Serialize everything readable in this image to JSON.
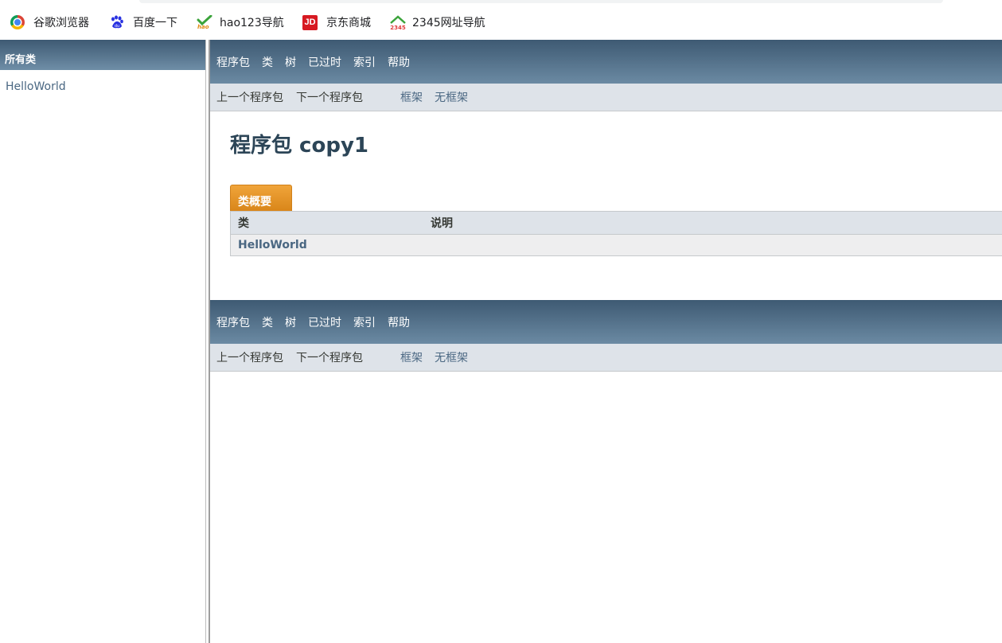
{
  "bookmarks": [
    {
      "label": "谷歌浏览器",
      "icon": "chrome-icon"
    },
    {
      "label": "百度一下",
      "icon": "baidu-paw-icon"
    },
    {
      "label": "hao123导航",
      "icon": "hao123-icon"
    },
    {
      "label": "京东商城",
      "icon": "jd-icon",
      "icon_text": "JD"
    },
    {
      "label": "2345网址导航",
      "icon": "2345-house-icon",
      "icon_text": "2345"
    }
  ],
  "left": {
    "header": "所有类",
    "classes": [
      "HelloWorld"
    ]
  },
  "nav": {
    "items": [
      "程序包",
      "类",
      "树",
      "已过时",
      "索引",
      "帮助"
    ],
    "prev_package": "上一个程序包",
    "next_package": "下一个程序包",
    "frames": "框架",
    "no_frames": "无框架"
  },
  "main": {
    "title": "程序包 copy1",
    "summary_tab": "类概要",
    "table": {
      "headers": [
        "类",
        "说明"
      ],
      "rows": [
        {
          "class": "HelloWorld",
          "description": ""
        }
      ]
    }
  },
  "colors": {
    "nav_gradient_top": "#3e5a73",
    "nav_gradient_bottom": "#6b8aa3",
    "subnav_bg": "#dee3e9",
    "tab_orange": "#e8962a",
    "link": "#4a6782"
  }
}
